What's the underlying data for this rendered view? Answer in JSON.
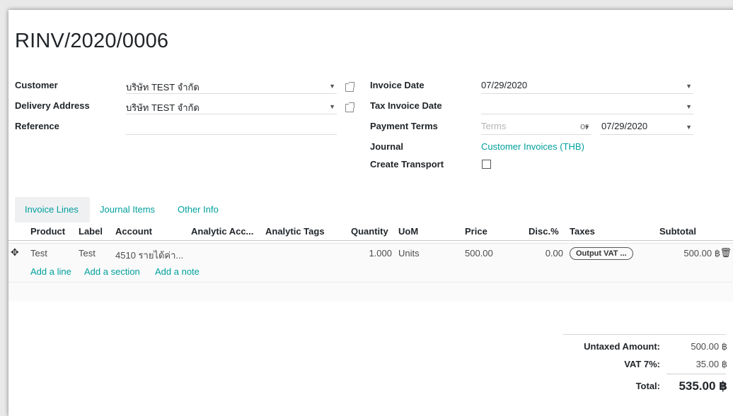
{
  "record": {
    "name": "RINV/2020/0006"
  },
  "left_fields": {
    "customer": {
      "label": "Customer",
      "value": "บริษัท TEST จำกัด"
    },
    "delivery": {
      "label": "Delivery Address",
      "value": "บริษัท TEST จำกัด"
    },
    "reference": {
      "label": "Reference",
      "value": ""
    }
  },
  "right_fields": {
    "invoice_date": {
      "label": "Invoice Date",
      "value": "07/29/2020"
    },
    "tax_invoice_date": {
      "label": "Tax Invoice Date",
      "value": ""
    },
    "payment_terms": {
      "label": "Payment Terms",
      "placeholder": "Terms",
      "or": "or",
      "due_date": "07/29/2020"
    },
    "journal": {
      "label": "Journal",
      "value": "Customer Invoices (THB)"
    },
    "create_transport": {
      "label": "Create Transport",
      "checked": false
    }
  },
  "tabs": [
    {
      "label": "Invoice Lines",
      "active": true
    },
    {
      "label": "Journal Items",
      "active": false
    },
    {
      "label": "Other Info",
      "active": false
    }
  ],
  "table": {
    "headers": [
      "Product",
      "Label",
      "Account",
      "Analytic Acc...",
      "Analytic Tags",
      "Quantity",
      "UoM",
      "Price",
      "Disc.%",
      "Taxes",
      "Subtotal"
    ],
    "rows": [
      {
        "product": "Test",
        "label": "Test",
        "account": "4510 รายได้ค่า...",
        "analytic_account": "",
        "analytic_tags": "",
        "quantity": "1.000",
        "uom": "Units",
        "price": "500.00",
        "discount": "0.00",
        "taxes": "Output VAT ...",
        "subtotal": "500.00 ฿"
      }
    ],
    "actions": [
      "Add a line",
      "Add a section",
      "Add a note"
    ]
  },
  "totals": {
    "untaxed": {
      "label": "Untaxed Amount:",
      "value": "500.00 ฿"
    },
    "vat": {
      "label": "VAT 7%:",
      "value": "35.00 ฿"
    },
    "total": {
      "label": "Total:",
      "value": "535.00 ฿"
    }
  },
  "colors": {
    "accent": "#00a09d",
    "text": "#212529",
    "muted": "#4c4c4c"
  },
  "icons": [
    "dropdown-caret-icon",
    "external-link-icon",
    "drag-handle-icon",
    "trash-icon"
  ]
}
